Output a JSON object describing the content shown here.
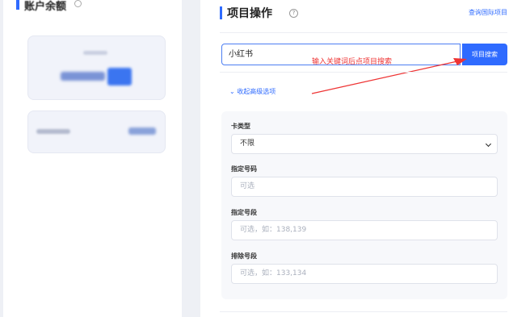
{
  "left": {
    "title": "账户余额"
  },
  "project": {
    "title": "项目操作",
    "help_icon": "?",
    "intl_link": "查询国际项目",
    "search_value": "小红书",
    "search_button": "项目搜索",
    "annotation": "输入关键词后点项目搜索",
    "annotation_color": "#ee3333",
    "collapse_label": "收起高级选项"
  },
  "advanced": {
    "card_type_label": "卡类型",
    "card_type_value": "不限",
    "number_label": "指定号码",
    "number_placeholder": "可选",
    "segment_label": "指定号段",
    "segment_placeholder": "可选，如：138,139",
    "exclude_label": "排除号段",
    "exclude_placeholder": "可选，如：133,134"
  },
  "colors": {
    "accent": "#2f6bff",
    "background": "#eef0f5"
  }
}
